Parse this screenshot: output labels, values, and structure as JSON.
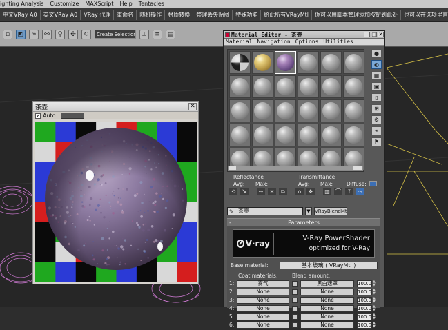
{
  "menubar": [
    "ighting Analysis",
    "Customize",
    "MAXScript",
    "Help",
    "Tentacles"
  ],
  "toolbar1": [
    "中文VRay A0",
    "英文VRay A0",
    "VRay 代理",
    "重命名",
    "随机操作",
    "材质转换",
    "整理丢失贴图",
    "特殊功能",
    "给此所有VRayMtl",
    "你可以用脚本管理添加按钮到此处",
    "也可以在选项里直接添加"
  ],
  "toolbar2": {
    "selection_set_placeholder": "Create Selection Se",
    "icons": [
      "select-region-icon",
      "link-icon",
      "unlink-icon",
      "bind-icon",
      "bind-warp-icon",
      "move-icon",
      "rotate-icon",
      "scale-icon"
    ]
  },
  "render_window": {
    "title": "茶壶",
    "auto_label": "Auto",
    "auto_checked": "✔",
    "close_glyph": "✕",
    "checker_colors": [
      "#1fa81f",
      "#2b3ad6",
      "#0a0a0a",
      "#d8d8d8",
      "#d51e1e",
      "#1fa81f",
      "#2b3ad6",
      "#0a0a0a"
    ]
  },
  "material_editor": {
    "title": "Material Editor - 茶壶",
    "menus": [
      "Material",
      "Navigation",
      "Options",
      "Utilities"
    ],
    "slot_rows": 5,
    "slot_cols": 6,
    "special_slots": [
      "checker",
      "gold",
      "purple"
    ],
    "side_tools": [
      "sample-type-icon",
      "backlight-icon",
      "background-icon",
      "uv-tiling-icon",
      "video-check-icon",
      "make-preview-icon",
      "options-icon",
      "select-by-material-icon",
      "material-navigator-icon"
    ],
    "reflectance_label": "Reflectance",
    "transmittance_label": "Transmittance",
    "avg_label": "Avg:",
    "max_label": "Max:",
    "diffuse_label": "Diffuse:",
    "material_name": "茶壶",
    "material_type": "VRayBlendMtl",
    "rollout_title": "Parameters",
    "rollout_toggle": "-",
    "banner": {
      "title": "V-Ray PowerShader",
      "subtitle": "optimized for V-Ray",
      "logo_text": "V·ray"
    },
    "base_material_label": "Base material:",
    "base_material_value": "基本玻璃 ( VRayMtl )",
    "coat_materials_label": "Coat materials:",
    "blend_amount_label": "Blend amount:",
    "coats": [
      {
        "idx": "1:",
        "mat": "雾气",
        "blend": "黑白遮罩",
        "amount": "100.0"
      },
      {
        "idx": "2:",
        "mat": "None",
        "blend": "None",
        "amount": "100.0"
      },
      {
        "idx": "3:",
        "mat": "None",
        "blend": "None",
        "amount": "100.0"
      },
      {
        "idx": "4:",
        "mat": "None",
        "blend": "None",
        "amount": "100.0"
      },
      {
        "idx": "5:",
        "mat": "None",
        "blend": "None",
        "amount": "100.0"
      },
      {
        "idx": "6:",
        "mat": "None",
        "blend": "None",
        "amount": "100.0"
      }
    ]
  },
  "colors": {
    "viewport_bg": "#262626",
    "wire_magenta": "#d37cd8",
    "wire_yellow": "#d9c447",
    "selection_blue": "#6e99c4"
  }
}
